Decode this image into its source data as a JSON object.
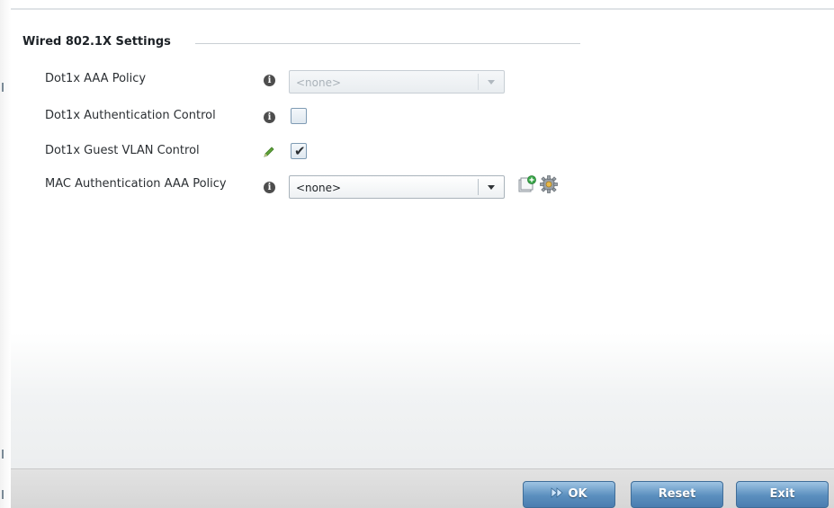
{
  "section": {
    "title": "Wired 802.1X Settings"
  },
  "fields": {
    "aaa_policy": {
      "label": "Dot1x AAA Policy",
      "value": "<none>",
      "disabled": true
    },
    "auth_control": {
      "label": "Dot1x Authentication Control",
      "checked": false
    },
    "guest_vlan": {
      "label": "Dot1x Guest VLAN Control",
      "checked": true,
      "check_glyph": "✔"
    },
    "mac_auth": {
      "label": "MAC Authentication AAA Policy",
      "value": "<none>"
    }
  },
  "icons": {
    "info": "i"
  },
  "footer": {
    "ok_label": "OK",
    "reset_label": "Reset",
    "exit_label": "Exit"
  }
}
